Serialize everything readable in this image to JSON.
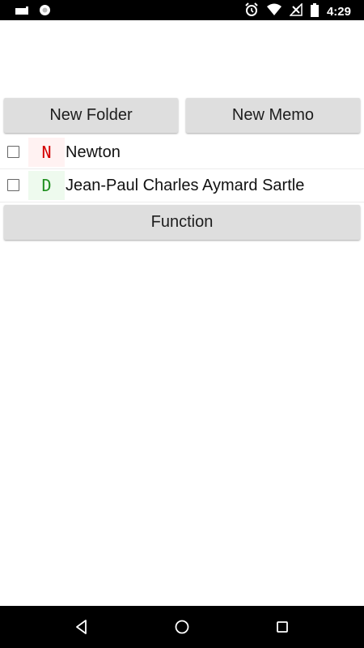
{
  "status_bar": {
    "time": "4:29",
    "left_icons": [
      "notification-icon",
      "sync-icon"
    ],
    "right_icons": [
      "alarm-icon",
      "wifi-icon",
      "signal-icon",
      "battery-icon"
    ]
  },
  "toolbar": {
    "new_folder_label": "New Folder",
    "new_memo_label": "New Memo"
  },
  "list": {
    "items": [
      {
        "badge": "N",
        "name": "Newton",
        "badge_color": "#d40000",
        "badge_bg": "#fff2f2",
        "checked": false
      },
      {
        "badge": "D",
        "name": "Jean-Paul Charles Aymard Sartle",
        "badge_color": "#1f8f1f",
        "badge_bg": "#eefaee",
        "checked": false
      }
    ]
  },
  "function_label": "Function",
  "nav_bar": {
    "icons": [
      "back-icon",
      "home-icon",
      "recents-icon"
    ]
  }
}
